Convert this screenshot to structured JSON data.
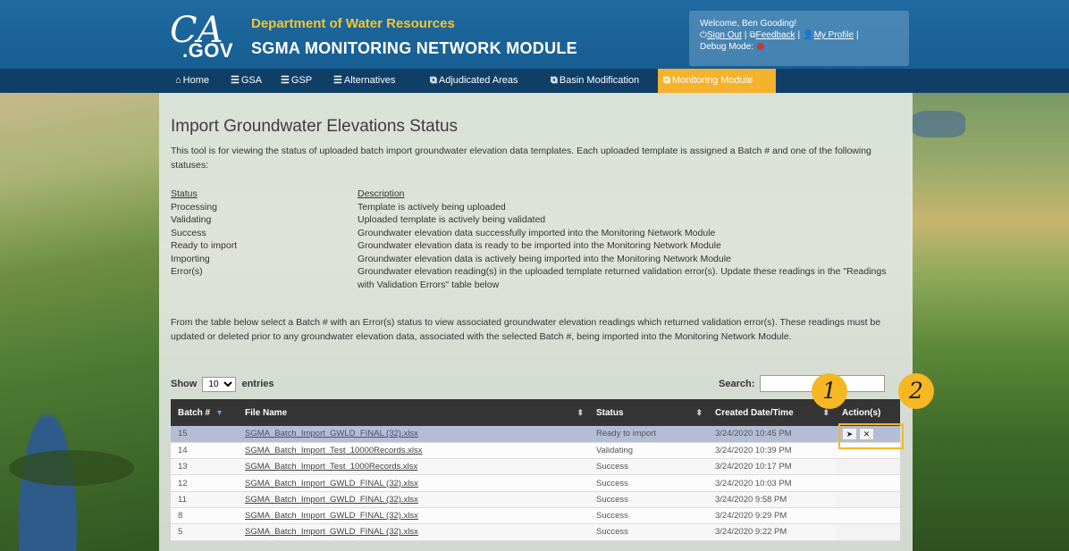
{
  "header": {
    "logo_ca": "CA",
    "logo_gov": ".GOV",
    "department": "Department of Water Resources",
    "module": "SGMA MONITORING NETWORK MODULE",
    "user": {
      "welcome": "Welcome, Ben Gooding!",
      "sign_out": "Sign Out",
      "feedback": "Feedback",
      "profile": "My Profile",
      "debug_label": "Debug Mode:"
    }
  },
  "nav": [
    {
      "icon": "home-icon",
      "glyph": "⌂",
      "label": "Home"
    },
    {
      "icon": "list-icon",
      "glyph": "☰",
      "label": "GSA"
    },
    {
      "icon": "list-icon",
      "glyph": "☰",
      "label": "GSP"
    },
    {
      "icon": "list-icon",
      "glyph": "☰",
      "label": "Alternatives"
    },
    {
      "icon": "external-icon",
      "glyph": "⧉",
      "label": "Adjudicated Areas"
    },
    {
      "icon": "external-icon",
      "glyph": "⧉",
      "label": "Basin Modification"
    },
    {
      "icon": "external-icon",
      "glyph": "⧉",
      "label": "Monitoring Module",
      "active": true
    }
  ],
  "page": {
    "title": "Import Groundwater Elevations Status",
    "intro": "This tool is for viewing the status of uploaded batch import groundwater elevation data templates. Each uploaded template is assigned a Batch # and one of the following statuses:",
    "status_header": "Status",
    "description_header": "Description",
    "statuses": [
      {
        "name": "Processing",
        "desc": "Template is actively being uploaded"
      },
      {
        "name": "Validating",
        "desc": "Uploaded template is actively being validated"
      },
      {
        "name": "Success",
        "desc": "Groundwater elevation data successfully imported into the Monitoring Network Module"
      },
      {
        "name": "Ready to import",
        "desc": "Groundwater elevation data is ready to be imported into the Monitoring Network Module"
      },
      {
        "name": "Importing",
        "desc": "Groundwater elevation data is actively being imported into the Monitoring Network Module"
      },
      {
        "name": "Error(s)",
        "desc": "Groundwater elevation reading(s) in the uploaded template returned validation error(s). Update these readings in the \"Readings with Validation Errors\" table below"
      }
    ],
    "para2": "From the table below select a Batch # with an Error(s) status to view associated groundwater elevation readings which returned validation error(s). These readings must be updated or deleted prior to any groundwater elevation data, associated with the selected Batch #, being imported into the Monitoring Network Module."
  },
  "table_controls": {
    "show_label": "Show",
    "entries_value": "10",
    "entries_label": "entries",
    "search_label": "Search:",
    "search_value": ""
  },
  "table": {
    "columns": [
      "Batch #",
      "File Name",
      "Status",
      "Created Date/Time",
      "Action(s)"
    ],
    "rows": [
      {
        "batch": "15",
        "file": "SGMA_Batch_Import_GWLD_FINAL (32).xlsx",
        "status": "Ready to import",
        "created": "3/24/2020 10:45 PM",
        "actions": true,
        "selected": true
      },
      {
        "batch": "14",
        "file": "SGMA_Batch_Import_Test_10000Records.xlsx",
        "status": "Validating",
        "created": "3/24/2020 10:39 PM"
      },
      {
        "batch": "13",
        "file": "SGMA_Batch_Import_Test_1000Records.xlsx",
        "status": "Success",
        "created": "3/24/2020 10:17 PM"
      },
      {
        "batch": "12",
        "file": "SGMA_Batch_Import_GWLD_FINAL (32).xlsx",
        "status": "Success",
        "created": "3/24/2020 10:03 PM"
      },
      {
        "batch": "11",
        "file": "SGMA_Batch_Import_GWLD_FINAL (32).xlsx",
        "status": "Success",
        "created": "3/24/2020 9:58 PM"
      },
      {
        "batch": "8",
        "file": "SGMA_Batch_Import_GWLD_FINAL (32).xlsx",
        "status": "Success",
        "created": "3/24/2020 9:29 PM"
      },
      {
        "batch": "5",
        "file": "SGMA_Batch_Import_GWLD_FINAL (32).xlsx",
        "status": "Success",
        "created": "3/24/2020 9:22 PM"
      }
    ],
    "action_icons": {
      "import": "send-icon",
      "delete": "close-icon"
    }
  },
  "callouts": [
    "1",
    "2"
  ],
  "colors": {
    "header_blue": "#1f6aa0",
    "nav_dark": "#0f3f66",
    "nav_active": "#f5b22c",
    "dept_gold": "#f5c531",
    "callout_gold": "#f6b724",
    "selected_row": "#b3bdd6"
  }
}
